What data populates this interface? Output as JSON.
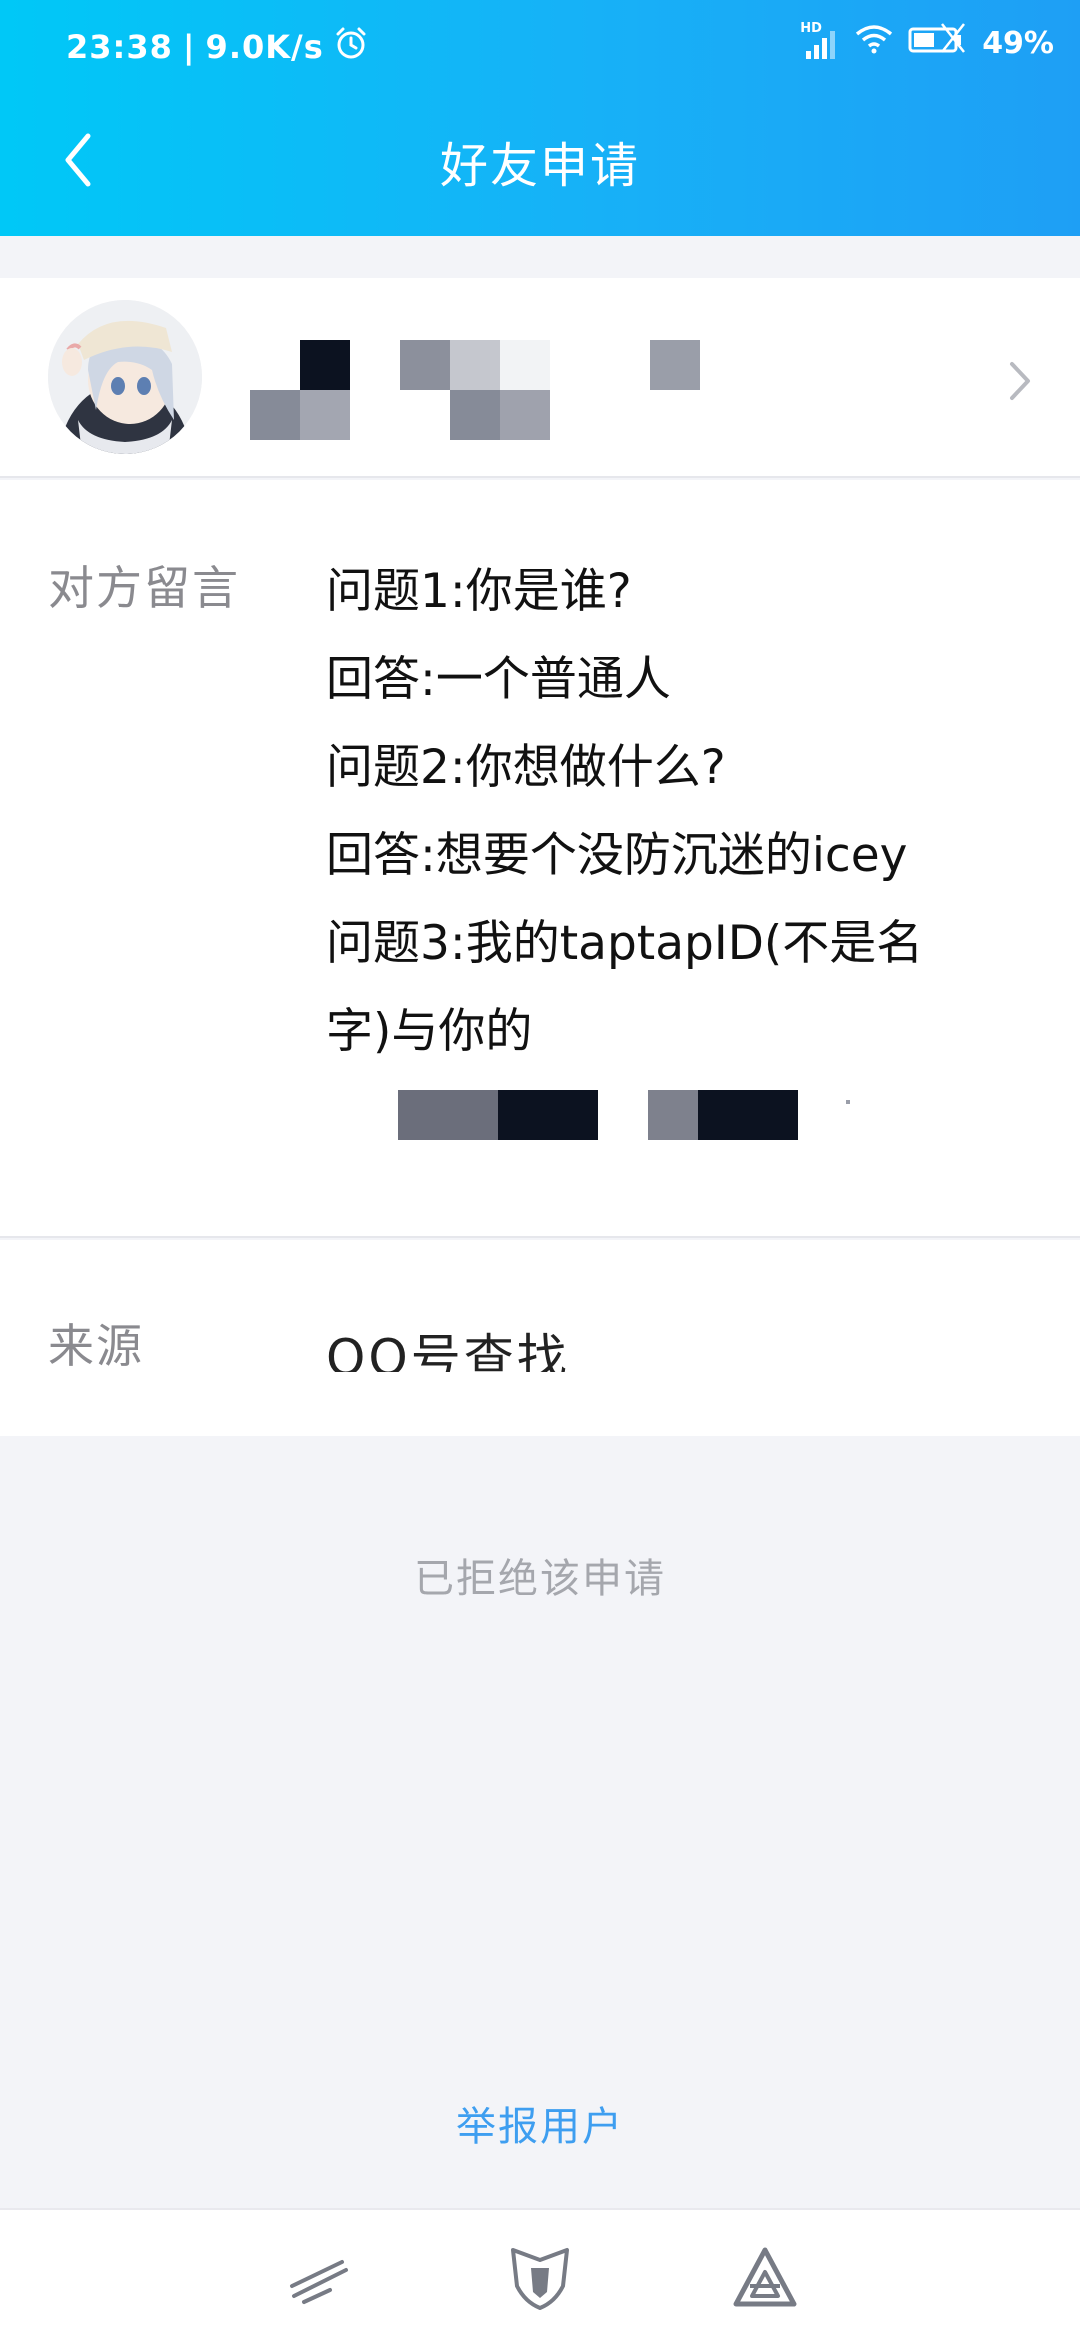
{
  "status_bar": {
    "time": "23:38",
    "separator": "|",
    "net_speed": "9.0K/s",
    "signal_tag": "HD",
    "battery": "49%"
  },
  "header": {
    "title": "好友申请"
  },
  "message": {
    "label": "对方留言",
    "lines": [
      "问题1:你是谁?",
      "回答:一个普通人",
      "问题2:你想做什么?",
      "回答:想要个没防沉迷的icey",
      "问题3:我的taptapID(不是名",
      "字)与你的"
    ]
  },
  "source": {
    "label": "来源",
    "value": "QQ号查找"
  },
  "status_text": "已拒绝该申请",
  "report_label": "举报用户",
  "icons": {
    "back": "chevron-left-icon",
    "forward": "chevron-right-icon",
    "alarm": "alarm-icon",
    "signal": "signal-icon",
    "wifi": "wifi-icon",
    "battery": "battery-icon",
    "nav_1": "slash-lines-icon",
    "nav_2": "shield-icon",
    "nav_3": "triangle-icon"
  },
  "colors": {
    "header_start": "#00c8f7",
    "header_end": "#1e9ff5",
    "link": "#3e9ef0",
    "muted": "#a5a7ad"
  }
}
